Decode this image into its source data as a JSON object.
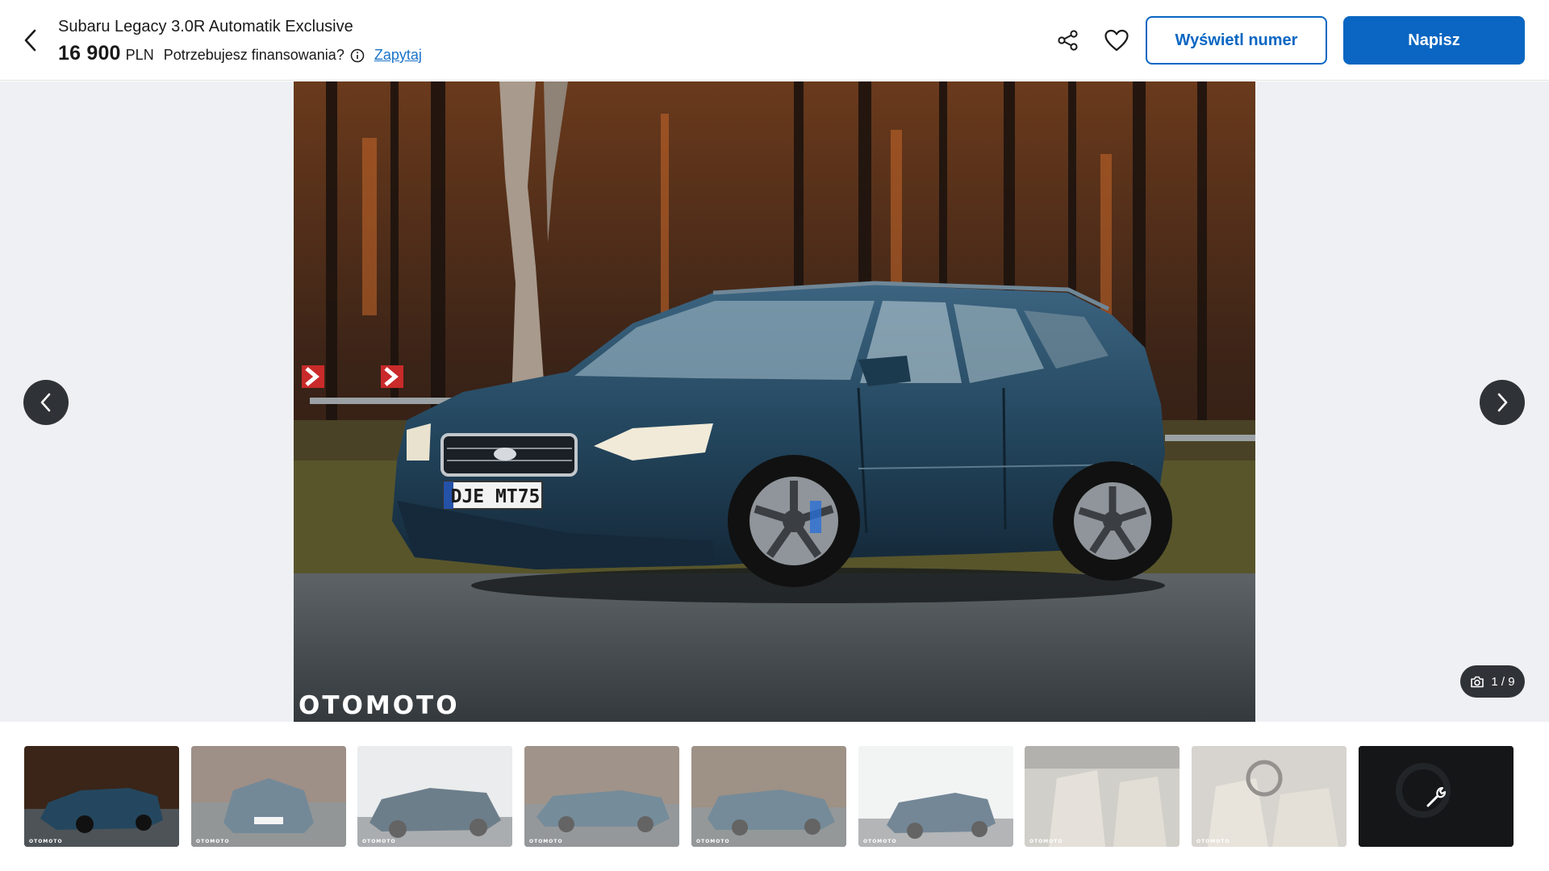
{
  "header": {
    "title": "Subaru Legacy 3.0R Automatik Exclusive",
    "price_amount": "16 900",
    "price_currency": "PLN",
    "finance_question": "Potrzebujesz finansowania?",
    "ask_link": "Zapytaj",
    "show_number_label": "Wyświetl numer",
    "write_label": "Napisz",
    "icons": [
      "chevron-left-icon",
      "info-icon",
      "share-icon",
      "heart-icon"
    ]
  },
  "gallery": {
    "watermark": "OTOMOTO",
    "plate_text": "DJE MT75",
    "counter": "1 / 9",
    "thumbnail_watermark": "OTOMOTO",
    "thumbnail_count": 9,
    "active_index": 1,
    "colors": {
      "car": "#23445a",
      "background": "#eef0f3",
      "button": "#2f3236",
      "accent": "#0a66c2"
    }
  }
}
